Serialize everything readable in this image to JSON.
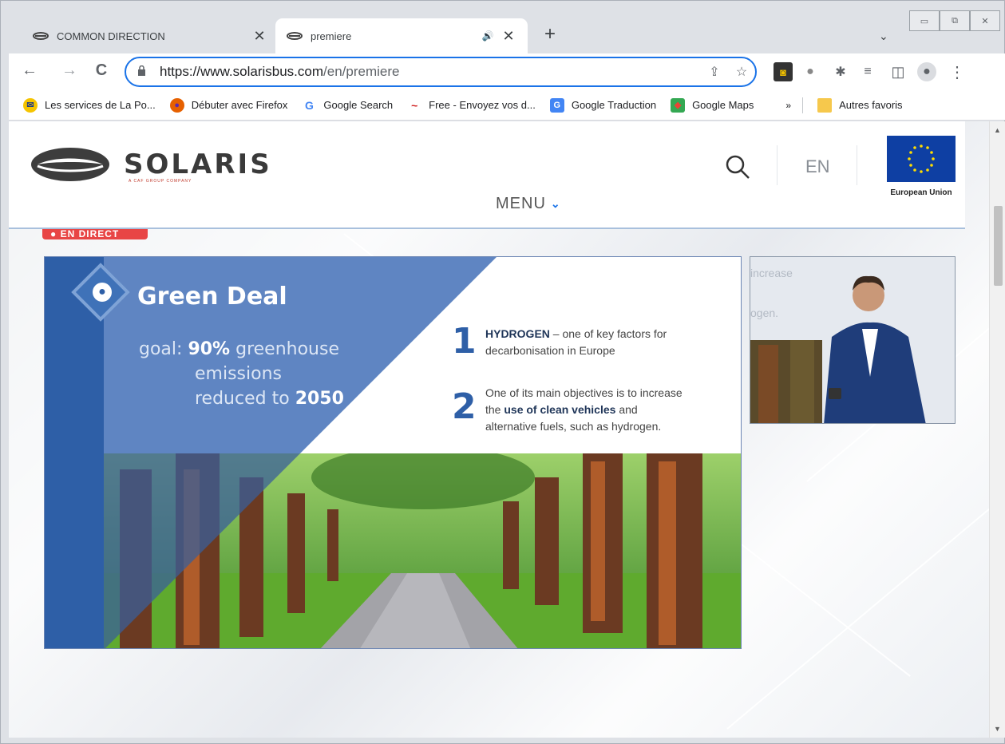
{
  "browser": {
    "tabs": [
      {
        "title": "COMMON DIRECTION",
        "active": false,
        "close": "✕"
      },
      {
        "title": "premiere",
        "active": true,
        "close": "✕",
        "audio": "🔊"
      }
    ],
    "new_tab": "+",
    "tab_dropdown": "⌄",
    "window_controls": {
      "minimize": "▭",
      "restore": "⧉",
      "close": "✕"
    },
    "nav": {
      "back": "←",
      "forward": "→",
      "reload": "C"
    },
    "url": {
      "prefix": "https://www.solarisbus.com",
      "path": "/en/premiere"
    },
    "omnibox_icons": {
      "share": "⇪",
      "star": "☆"
    },
    "toolbar_icons": {
      "ext1": "◙",
      "ext2": "●",
      "puzzle": "✱",
      "reading_list": "≡",
      "side_panel": "◫",
      "profile": "●",
      "more": "⋮"
    },
    "bookmarks": [
      {
        "label": "Les services de La Po...",
        "icon_color": "#f5c400",
        "icon_glyph": "✉"
      },
      {
        "label": "Débuter avec Firefox",
        "icon_color": "#e66000",
        "icon_glyph": "●"
      },
      {
        "label": "Google Search",
        "icon_color": "#ffffff",
        "icon_glyph": "G"
      },
      {
        "label": "Free - Envoyez vos d...",
        "icon_color": "#ffffff",
        "icon_glyph": "~"
      },
      {
        "label": "Google Traduction",
        "icon_color": "#4285f4",
        "icon_glyph": "G"
      },
      {
        "label": "Google Maps",
        "icon_color": "#34a853",
        "icon_glyph": "◆"
      }
    ],
    "bookmarks_overflow": "»",
    "other_bookmarks": "Autres favoris"
  },
  "site": {
    "logo_text": "SOLARIS",
    "logo_sub": "A CAF GROUP COMPANY",
    "lang": "EN",
    "eu_label": "European Union",
    "menu_label": "MENU",
    "live_badge": "● EN DIRECT"
  },
  "slide": {
    "title": "Green Deal",
    "goal_prefix": "goal:",
    "goal_pct": "90%",
    "goal_line1_rest": " greenhouse",
    "goal_line2": "emissions",
    "goal_line3_pre": "reduced to ",
    "goal_year": "2050",
    "points": [
      {
        "num": "1",
        "bold": "HYDROGEN",
        "text_after": " – one of key factors for",
        "line2": "decarbonisation in Europe"
      },
      {
        "num": "2",
        "line1": "One of its main objectives is to increase",
        "pre": "the ",
        "bold": "use of clean vehicles",
        "post": " and",
        "line3": "alternative fuels, such as hydrogen."
      }
    ]
  },
  "video": {
    "ghost_line1": "increase",
    "ghost_line2": "ogen."
  },
  "colors": {
    "slide_blue": "#2e5fa7",
    "slide_blue_light": "#5f85c2",
    "omnibox_border": "#1a73e8",
    "live_red": "#e84545"
  }
}
